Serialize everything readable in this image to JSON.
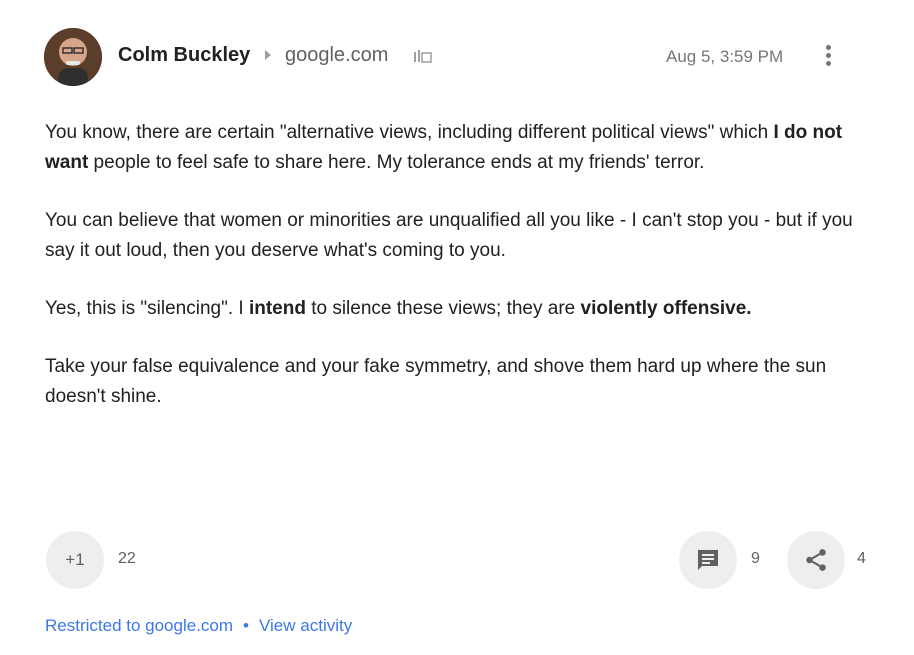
{
  "post": {
    "author": "Colm Buckley",
    "domain": "google.com",
    "timestamp": "Aug 5, 3:59 PM",
    "paragraphs": [
      [
        {
          "text": "You know, there are certain \"alternative views, including different political views\" which ",
          "bold": false
        },
        {
          "text": "I do not want",
          "bold": true
        },
        {
          "text": " people to feel safe to share here. My tolerance ends at my friends' terror.",
          "bold": false
        }
      ],
      [
        {
          "text": "You can believe that women or minorities are unqualified all you like - I can't stop you - but if you say it out loud, then you deserve what's coming to you.",
          "bold": false
        }
      ],
      [
        {
          "text": "Yes, this is \"silencing\". I ",
          "bold": false
        },
        {
          "text": "intend",
          "bold": true
        },
        {
          "text": " to silence these views; they are ",
          "bold": false
        },
        {
          "text": "violently offensive.",
          "bold": true
        }
      ],
      [
        {
          "text": "Take your false equivalence and your fake symmetry, and shove them hard up where the sun doesn't shine.",
          "bold": false
        }
      ]
    ]
  },
  "actions": {
    "plusone_label": "+1",
    "plusone_count": "22",
    "comment_count": "9",
    "share_count": "4",
    "icons": {
      "comment": "comment-icon",
      "share": "share-icon",
      "menu": "more-vert-icon",
      "domain": "domain-icon"
    }
  },
  "footer": {
    "restricted_text": "Restricted to google.com",
    "separator": "•",
    "view_activity": "View activity"
  },
  "colors": {
    "link": "#3b78e7",
    "button_bg": "#eeeeee",
    "icon_gray": "#757575"
  }
}
